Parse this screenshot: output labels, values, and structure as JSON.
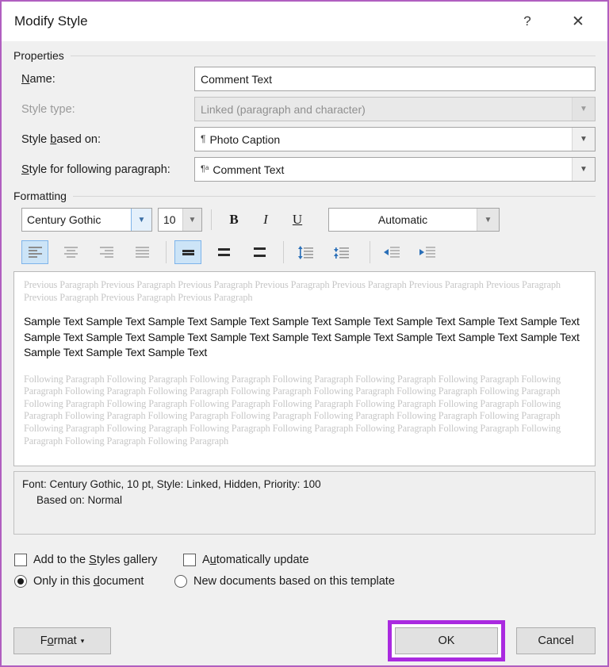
{
  "window": {
    "title": "Modify Style",
    "help_icon": "?",
    "close_icon": "✕"
  },
  "properties": {
    "group_label": "Properties",
    "name": {
      "label": "Name:",
      "label_accel": "N",
      "value": "Comment Text"
    },
    "style_type": {
      "label": "Style type:",
      "value": "Linked (paragraph and character)",
      "disabled": true
    },
    "style_based_on": {
      "label": "Style based on:",
      "label_accel": "b",
      "value": "Photo Caption",
      "icon": "pilcrow-icon"
    },
    "style_following": {
      "label": "Style for following paragraph:",
      "label_accel": "S",
      "value": "Comment Text",
      "icon": "pilcrow-a-icon"
    }
  },
  "formatting": {
    "group_label": "Formatting",
    "font_family": "Century Gothic",
    "font_size": "10",
    "bold": "B",
    "italic": "I",
    "underline": "U",
    "font_color": "Automatic",
    "align_buttons": [
      "align-left",
      "align-center",
      "align-right",
      "align-justify"
    ],
    "spacing_buttons": [
      "line-spacing-single",
      "line-spacing-1.5",
      "line-spacing-double"
    ],
    "para_space_buttons": [
      "increase-paragraph-spacing",
      "decrease-paragraph-spacing"
    ],
    "indent_buttons": [
      "decrease-indent",
      "increase-indent"
    ],
    "active_align": "align-left",
    "active_spacing": "line-spacing-single"
  },
  "preview": {
    "previous_paragraph": "Previous Paragraph Previous Paragraph Previous Paragraph Previous Paragraph Previous Paragraph Previous Paragraph Previous Paragraph Previous Paragraph Previous Paragraph Previous Paragraph",
    "sample_text": "Sample Text Sample Text Sample Text Sample Text Sample Text Sample Text Sample Text Sample Text Sample Text Sample Text Sample Text Sample Text Sample Text Sample Text Sample Text Sample Text Sample Text Sample Text Sample Text Sample Text Sample Text",
    "following_paragraph": "Following Paragraph Following Paragraph Following Paragraph Following Paragraph Following Paragraph Following Paragraph Following Paragraph Following Paragraph Following Paragraph Following Paragraph Following Paragraph Following Paragraph Following Paragraph Following Paragraph Following Paragraph Following Paragraph Following Paragraph Following Paragraph Following Paragraph Following Paragraph Following Paragraph Following Paragraph Following Paragraph Following Paragraph Following Paragraph Following Paragraph Following Paragraph Following Paragraph Following Paragraph Following Paragraph Following Paragraph Following Paragraph Following Paragraph Following Paragraph Following Paragraph"
  },
  "description": {
    "line1": "Font: Century Gothic, 10 pt, Style: Linked, Hidden, Priority: 100",
    "line2": "Based on: Normal"
  },
  "options": {
    "add_to_gallery": {
      "label": "Add to the Styles gallery",
      "checked": false
    },
    "auto_update": {
      "label": "Automatically update",
      "checked": false
    },
    "only_this_document": {
      "label": "Only in this document",
      "checked": true
    },
    "new_documents": {
      "label": "New documents based on this template",
      "checked": false
    }
  },
  "footer": {
    "format_label": "Format",
    "format_caret": "▾",
    "ok_label": "OK",
    "cancel_label": "Cancel"
  },
  "colors": {
    "dialog_border": "#b05fc0",
    "highlight": "#aa2ae0",
    "accent_blue": "#7eb4ea"
  }
}
